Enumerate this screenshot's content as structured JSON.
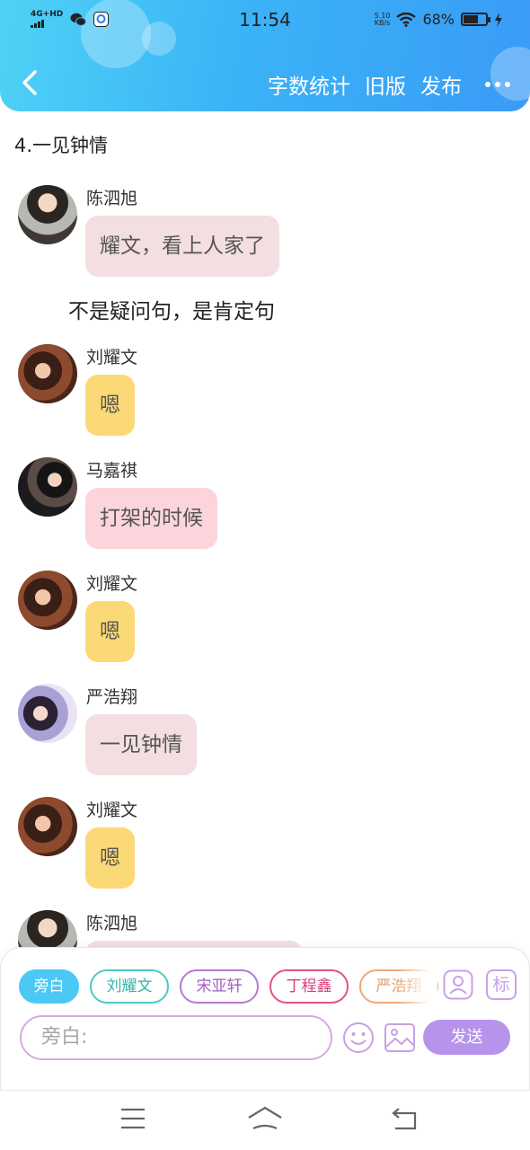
{
  "status_bar": {
    "network": "4G+HD",
    "time": "11:54",
    "net_speed_value": "5.10",
    "net_speed_unit": "KB/s",
    "battery": "68%",
    "battery_level": 0.68
  },
  "toolbar": {
    "word_count": "字数统计",
    "old_version": "旧版",
    "publish": "发布"
  },
  "chapter_title": "4.一见钟情",
  "narration": "不是疑问句，是肯定句",
  "messages": [
    {
      "sender": "陈泗旭",
      "text": "耀文，看上人家了",
      "bubble_color": "#f3dfe1"
    },
    {
      "sender": "刘耀文",
      "text": "嗯",
      "bubble_color": "#fcd977"
    },
    {
      "sender": "马嘉祺",
      "text": "打架的时候",
      "bubble_color": "#fcd5dc"
    },
    {
      "sender": "刘耀文",
      "text": "嗯",
      "bubble_color": "#fcd977"
    },
    {
      "sender": "严浩翔",
      "text": "一见钟情",
      "bubble_color": "#f3dfe1"
    },
    {
      "sender": "刘耀文",
      "text": "嗯",
      "bubble_color": "#fcd977"
    },
    {
      "sender": "陈泗旭",
      "text": "",
      "bubble_color": "#f3dfe1"
    }
  ],
  "roles": [
    {
      "label": "旁白",
      "color": "#4cc8f4",
      "selected": true
    },
    {
      "label": "刘耀文",
      "color": "#4cc9c2",
      "selected": false
    },
    {
      "label": "宋亚轩",
      "color": "#b57ad0",
      "selected": false
    },
    {
      "label": "丁程鑫",
      "color": "#e3508a",
      "selected": false
    },
    {
      "label": "严浩翔",
      "color": "#f0a873",
      "selected": false
    }
  ],
  "input": {
    "placeholder": "旁白:"
  },
  "actions": {
    "send": "发送",
    "tag": "标"
  },
  "accent_color": "#b793ec"
}
